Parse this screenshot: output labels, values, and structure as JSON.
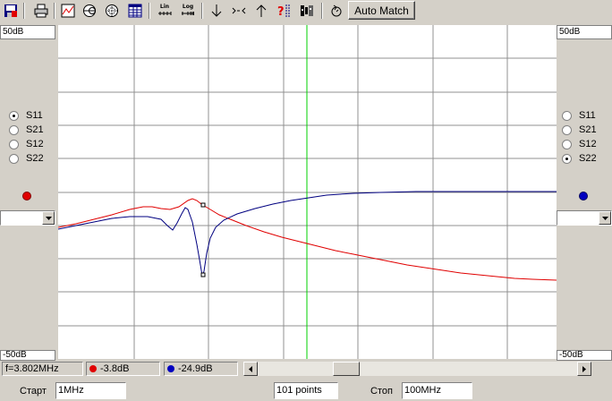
{
  "toolbar": {
    "icons": [
      "save-icon",
      "print-icon",
      "chart-view-icon",
      "smith-chart-icon",
      "polar-chart-icon",
      "table-icon",
      "lin-scale-icon",
      "log-scale-icon",
      "marker-down-icon",
      "zoom-fit-icon",
      "marker-up-icon",
      "help-icon",
      "calibrate-icon",
      "refresh-icon"
    ],
    "lin_label": "Lin",
    "log_label": "Log",
    "auto_match_label": "Auto Match"
  },
  "left_panel": {
    "top_ref": "50dB",
    "bottom_ref": "-50dB",
    "options": [
      "S11",
      "S21",
      "S12",
      "S22"
    ],
    "selected": "S11",
    "trace_color": "#e00000"
  },
  "right_panel": {
    "top_ref": "50dB",
    "bottom_ref": "-50dB",
    "options": [
      "S11",
      "S21",
      "S12",
      "S22"
    ],
    "selected": "S22",
    "trace_color": "#0000c0"
  },
  "plot": {
    "background": "#ffffff",
    "grid_color": "#909090",
    "marker_color": "#00d000",
    "red_trace": "#e00000",
    "blue_trace": "#000080"
  },
  "status": {
    "frequency": "f=3.802MHz",
    "marker1_value": "-3.8dB",
    "marker2_value": "-24.9dB"
  },
  "bottom": {
    "start_label": "Старт",
    "start_value": "1MHz",
    "points_value": "101 points",
    "stop_label": "Стоп",
    "stop_value": "100MHz"
  }
}
